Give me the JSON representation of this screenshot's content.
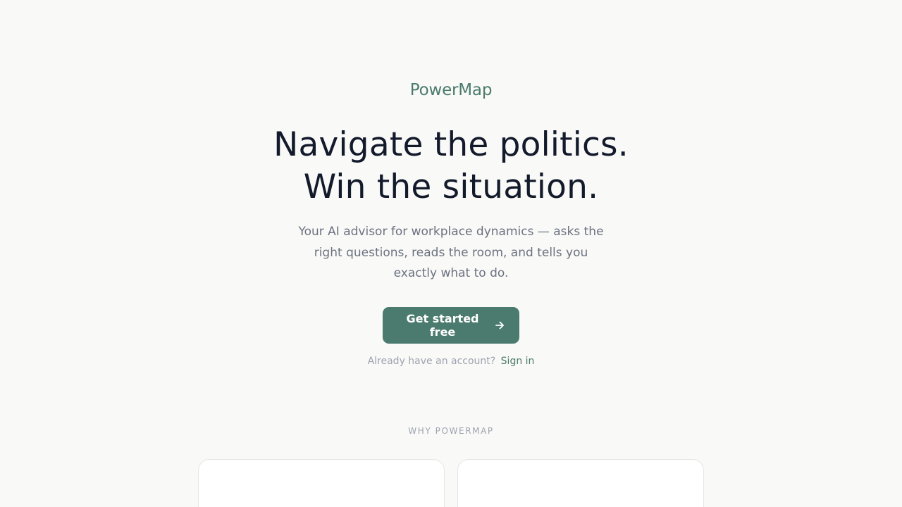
{
  "brand": {
    "name": "PowerMap"
  },
  "hero": {
    "headline_line1": "Navigate the politics.",
    "headline_line2": "Win the situation.",
    "subtitle": "Your AI advisor for workplace dynamics — asks the right questions, reads the room, and tells you exactly what to do."
  },
  "cta": {
    "label": "Get started free",
    "icon": "arrow-right-icon"
  },
  "signin": {
    "prompt": "Already have an account?",
    "link_label": "Sign in"
  },
  "why": {
    "label": "WHY POWERMAP"
  },
  "colors": {
    "accent": "#4b7b6e",
    "heading": "#131a2b",
    "muted": "#6b7280",
    "background": "#f9f9f7"
  }
}
